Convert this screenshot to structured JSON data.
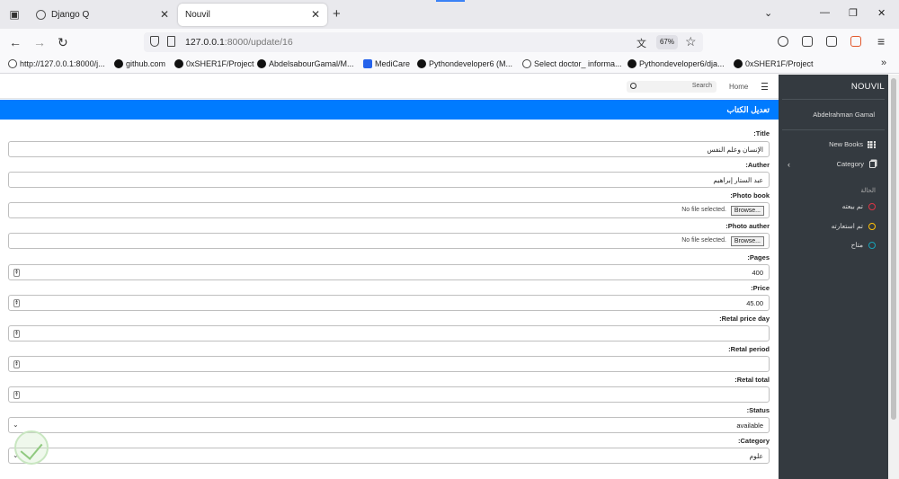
{
  "browser": {
    "tabs": [
      {
        "title": "Django Q",
        "active": false
      },
      {
        "title": "Nouvil",
        "active": true
      }
    ],
    "url_host": "127.0.0.1",
    "url_path": ":8000/update/16",
    "zoom": "67%",
    "bookmarks": [
      {
        "label": "http://127.0.0.1:8000/j...",
        "icon": "globe-icon"
      },
      {
        "label": "github.com",
        "icon": "github-icon"
      },
      {
        "label": "0xSHER1F/Project",
        "icon": "github-icon"
      },
      {
        "label": "AbdelsabourGamal/M...",
        "icon": "github-icon"
      },
      {
        "label": "MediCare",
        "icon": "medicare-icon"
      },
      {
        "label": "Pythondeveloper6 (M...",
        "icon": "github-icon"
      },
      {
        "label": "Select doctor_ informa...",
        "icon": "globe-icon"
      },
      {
        "label": "Pythondeveloper6/dja...",
        "icon": "github-icon"
      },
      {
        "label": "0xSHER1F/Project",
        "icon": "github-icon"
      }
    ]
  },
  "topnav": {
    "search_placeholder": "Search",
    "home": "Home"
  },
  "page_title": "تعديل الكتاب",
  "form": {
    "title_label": ":Title",
    "title_value": "الإنسان وعلم النفس",
    "author_label": ":Auther",
    "author_value": "عبد الستار إبراهيم",
    "photo_book_label": ":Photo book",
    "photo_author_label": ":Photo auther",
    "browse_label": "Browse...",
    "no_file_label": "No file selected.",
    "pages_label": ":Pages",
    "pages_value": "400",
    "price_label": ":Price",
    "price_value": "45.00",
    "retal_price_day_label": ":Retal price day",
    "retal_period_label": ":Retal period",
    "retal_total_label": ":Retal total",
    "status_label": ":Status",
    "status_value": "available",
    "category_label": ":Category",
    "category_value": "علوم"
  },
  "sidebar": {
    "brand": "NOUVIL",
    "user": "Abdelrahman Gamal",
    "new_books": "New Books",
    "category": "Category",
    "status_heading": "الحالة",
    "statuses": [
      {
        "label": "تم بيعته",
        "color": "#dc3545"
      },
      {
        "label": "تم استعارته",
        "color": "#ffc107"
      },
      {
        "label": "متاح",
        "color": "#17a2b8"
      }
    ]
  },
  "colors": {
    "title_bar": "#007bff",
    "sidebar_bg": "#343a40"
  }
}
